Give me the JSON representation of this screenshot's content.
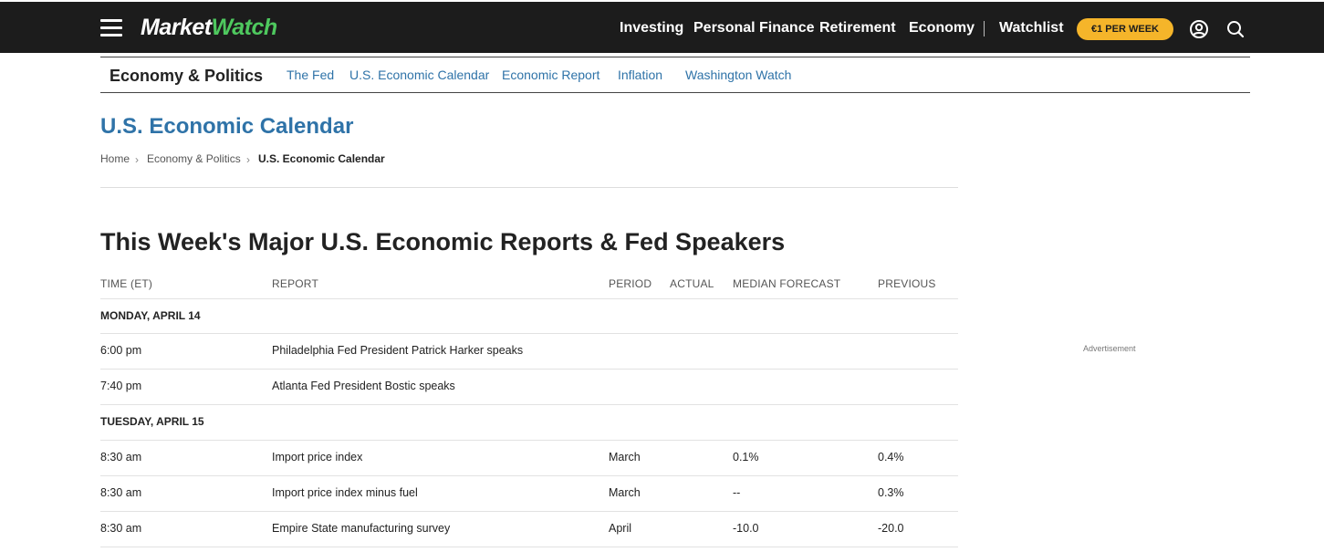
{
  "header": {
    "logo_part1": "Market",
    "logo_part2": "Watch",
    "nav": [
      "Investing",
      "Personal Finance",
      "Retirement",
      "Economy"
    ],
    "watchlist": "Watchlist",
    "subscribe": "€1 PER WEEK",
    "icons": [
      "menu-icon",
      "user-icon",
      "search-icon"
    ],
    "colors": {
      "bar": "#1c1c1c",
      "logo_accent": "#4ec85e",
      "subscribe": "#f5b52a"
    }
  },
  "section": {
    "title": "Economy & Politics",
    "links": [
      "The Fed",
      "U.S. Economic Calendar",
      "Economic Report",
      "Inflation",
      "Washington Watch"
    ],
    "link_color": "#2f73a8"
  },
  "page": {
    "title": "U.S. Economic Calendar",
    "breadcrumb": [
      "Home",
      "Economy & Politics",
      "U.S. Economic Calendar"
    ]
  },
  "calendar": {
    "heading": "This Week's Major U.S. Economic Reports & Fed Speakers",
    "columns": [
      "TIME (ET)",
      "REPORT",
      "PERIOD",
      "ACTUAL",
      "MEDIAN FORECAST",
      "PREVIOUS"
    ],
    "days": [
      {
        "label": "MONDAY, APRIL 14",
        "rows": [
          {
            "time": "6:00 pm",
            "report": "Philadelphia Fed President Patrick Harker speaks",
            "period": "",
            "actual": "",
            "forecast": "",
            "previous": ""
          },
          {
            "time": "7:40 pm",
            "report": "Atlanta Fed President Bostic speaks",
            "period": "",
            "actual": "",
            "forecast": "",
            "previous": ""
          }
        ]
      },
      {
        "label": "TUESDAY, APRIL 15",
        "rows": [
          {
            "time": "8:30 am",
            "report": "Import price index",
            "period": "March",
            "actual": "",
            "forecast": "0.1%",
            "previous": "0.4%"
          },
          {
            "time": "8:30 am",
            "report": "Import price index minus fuel",
            "period": "March",
            "actual": "",
            "forecast": "--",
            "previous": "0.3%"
          },
          {
            "time": "8:30 am",
            "report": "Empire State manufacturing survey",
            "period": "April",
            "actual": "",
            "forecast": "-10.0",
            "previous": "-20.0"
          }
        ]
      }
    ]
  },
  "sidebar": {
    "ad_label": "Advertisement"
  }
}
